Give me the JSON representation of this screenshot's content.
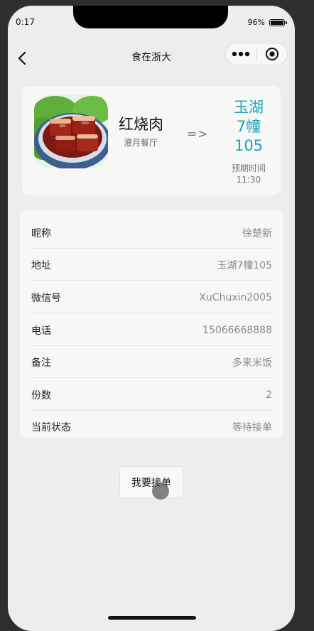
{
  "status_bar": {
    "time": "0:17",
    "battery": "96%",
    "battery_level": 0.96
  },
  "nav": {
    "title": "食在浙大",
    "back_icon": "chevron-left-icon",
    "more_icon": "more-dots-icon",
    "close_icon": "target-icon"
  },
  "order": {
    "food_name": "红烧肉",
    "restaurant": "澄月餐厅",
    "arrow": "=>",
    "destination_lines": [
      "玉湖",
      "7幢",
      "105"
    ],
    "eta_label": "预期时间",
    "eta_time": "11:30",
    "accent_color": "#19a3b8"
  },
  "info_rows": [
    {
      "label": "昵称",
      "value": "徐楚新"
    },
    {
      "label": "地址",
      "value": "玉湖7幢105"
    },
    {
      "label": "微信号",
      "value": "XuChuxin2005"
    },
    {
      "label": "电话",
      "value": "15066668888"
    },
    {
      "label": "备注",
      "value": "多来米饭"
    },
    {
      "label": "份数",
      "value": "2"
    },
    {
      "label": "当前状态",
      "value": "等待接单"
    }
  ],
  "accept_button": {
    "label": "我要接单"
  }
}
